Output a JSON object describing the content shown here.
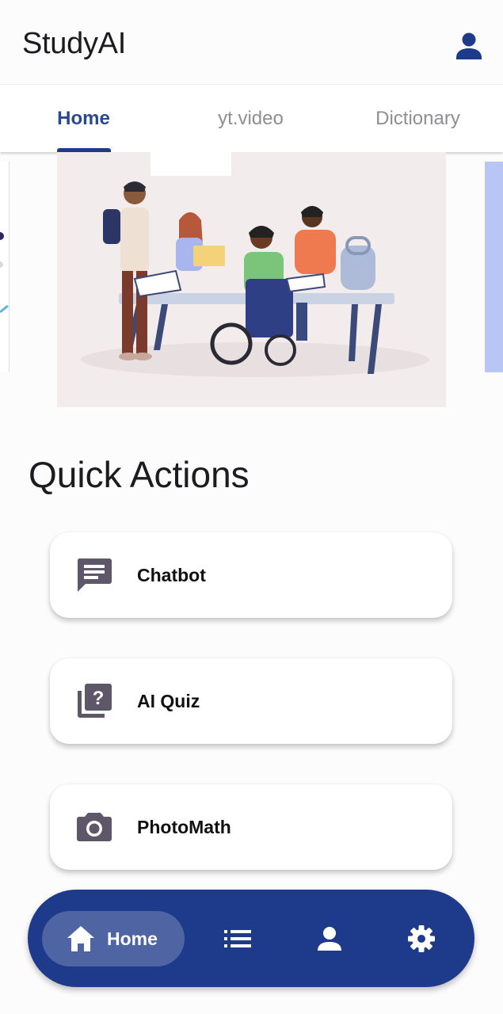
{
  "app": {
    "title": "StudyAI"
  },
  "tabs": [
    {
      "label": "Home",
      "active": true
    },
    {
      "label": "yt.video",
      "active": false
    },
    {
      "label": "Dictionary",
      "active": false
    }
  ],
  "carousel": {
    "current_slide": "students-studying-illustration"
  },
  "quick_actions": {
    "title": "Quick Actions",
    "items": [
      {
        "label": "Chatbot",
        "icon": "chat-icon"
      },
      {
        "label": "AI Quiz",
        "icon": "quiz-icon"
      },
      {
        "label": "PhotoMath",
        "icon": "camera-icon"
      }
    ]
  },
  "bottom_nav": {
    "items": [
      {
        "label": "Home",
        "icon": "home-icon",
        "active": true
      },
      {
        "label": "",
        "icon": "list-icon",
        "active": false
      },
      {
        "label": "",
        "icon": "person-icon",
        "active": false
      },
      {
        "label": "",
        "icon": "settings-icon",
        "active": false
      }
    ]
  },
  "colors": {
    "primary": "#1e3a8a",
    "tab_active": "#2a4a8f",
    "tab_inactive": "#8e8e93",
    "icon_muted": "#5d5769",
    "background": "#fdfcfd"
  }
}
